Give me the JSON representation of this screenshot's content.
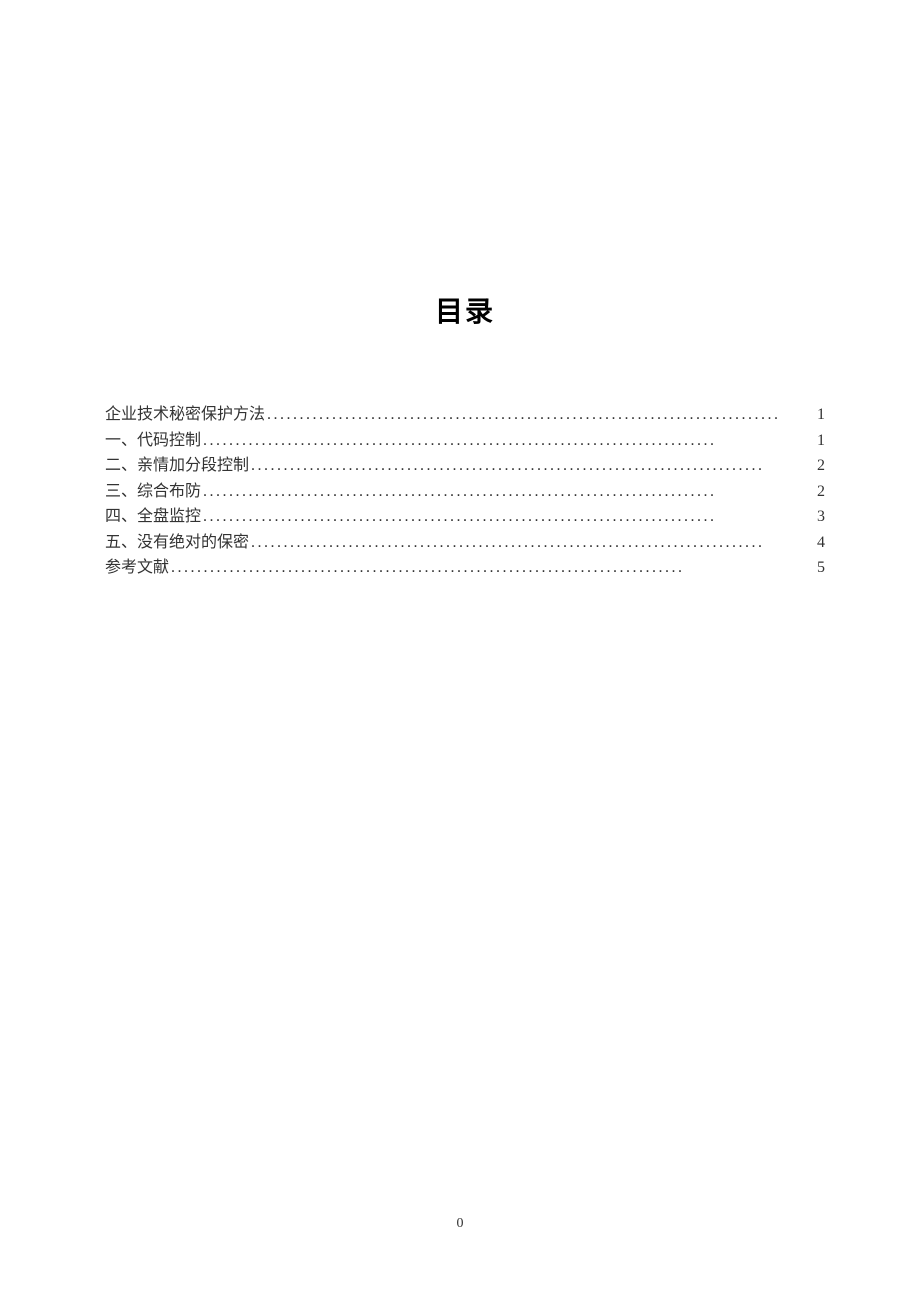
{
  "toc": {
    "title": "目录",
    "entries": [
      {
        "label": "企业技术秘密保护方法",
        "page": "1"
      },
      {
        "label": "一、代码控制",
        "page": "1"
      },
      {
        "label": "二、亲情加分段控制",
        "page": "2"
      },
      {
        "label": "三、综合布防",
        "page": "2"
      },
      {
        "label": "四、全盘监控",
        "page": "3"
      },
      {
        "label": "五、没有绝对的保密",
        "page": "4"
      },
      {
        "label": "参考文献",
        "page": "5"
      }
    ]
  },
  "pageNumber": "0"
}
